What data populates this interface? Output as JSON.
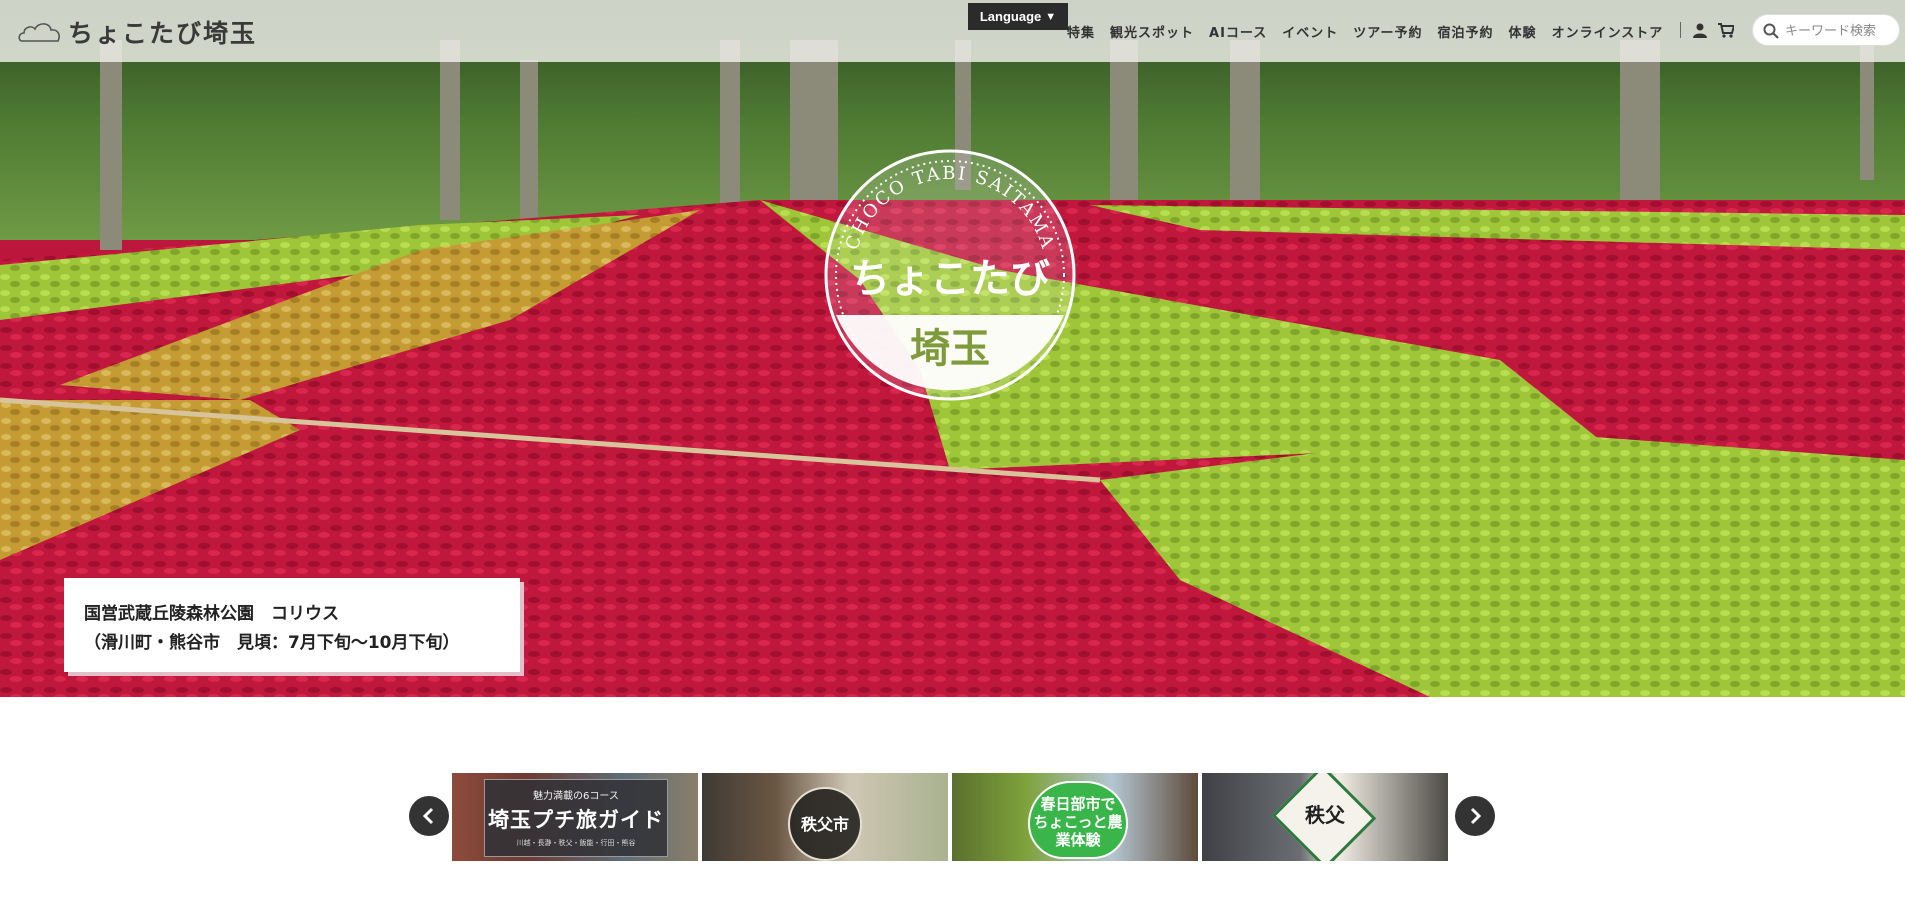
{
  "header": {
    "logo_text": "ちょこたび埼玉",
    "language_label": "Language",
    "nav": [
      "特集",
      "観光スポット",
      "AIコース",
      "イベント",
      "ツアー予約",
      "宿泊予約",
      "体験",
      "オンラインストア"
    ],
    "search_placeholder": "キーワード検索"
  },
  "hero": {
    "seal": {
      "arc_text": "CHOCO TABI SAITAMA",
      "title": "ちょこたび",
      "subtitle": "埼玉"
    },
    "caption": {
      "line1": "国営武蔵丘陵森林公園　コリウス",
      "line2": "（滑川町・熊谷市　見頃：7月下旬〜10月下旬）"
    }
  },
  "carousel": {
    "banners": [
      {
        "subtitle": "魅力満載の6コース",
        "title": "埼玉プチ旅ガイド",
        "footer": "川越・長瀞・秩父・飯能・行田・熊谷"
      },
      {
        "title": "秩父市"
      },
      {
        "title": "春日部市で\nちょこっと農業体験"
      },
      {
        "title": "秩父"
      }
    ]
  },
  "colors": {
    "header_bg": "#f0f0ec",
    "language_bg": "#2b2b2b",
    "coleus_red": "#c3183f",
    "coleus_lime": "#a7d23c",
    "coleus_gold": "#c9a23a"
  }
}
